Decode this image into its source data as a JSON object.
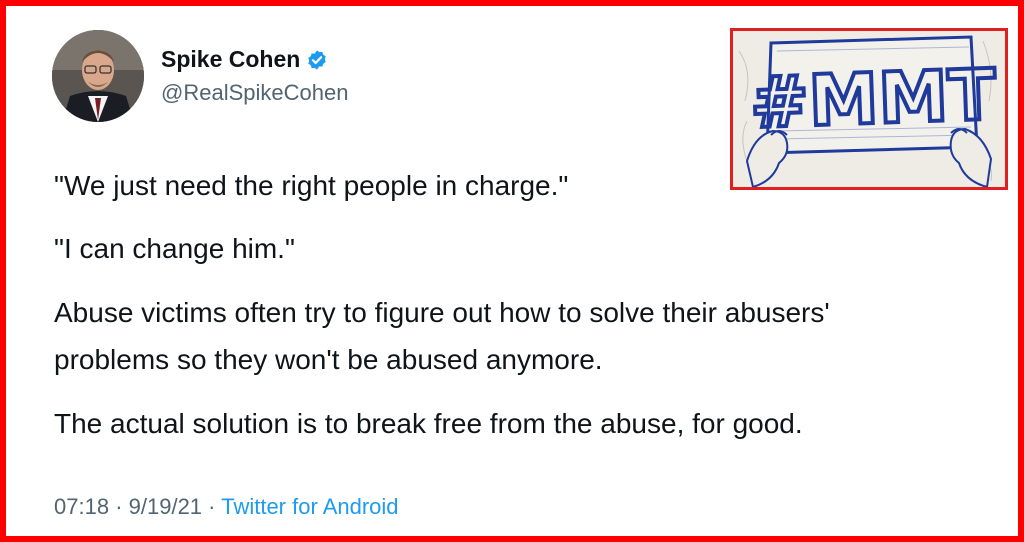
{
  "tweet": {
    "author_name": "Spike Cohen",
    "author_handle": "@RealSpikeCohen",
    "lines": [
      "\"We just need the right people in charge.\"",
      "\"I can change him.\"",
      "Abuse victims often try to figure out how to solve their abusers'",
      "problems so they won't be abused anymore.",
      "The actual solution is to break free from the abuse, for good."
    ],
    "time": "07:18",
    "separator": "·",
    "date": "9/19/21",
    "source": "Twitter for Android"
  },
  "image": {
    "sign_text": "#MMT"
  },
  "colors": {
    "frame": "#ff0000",
    "text": "#0f1419",
    "muted": "#536471",
    "link": "#1d9bf0",
    "verified": "#1d9bf0",
    "ink": "#1f3a9a"
  },
  "icons": {
    "verified": "verified-badge-icon"
  }
}
